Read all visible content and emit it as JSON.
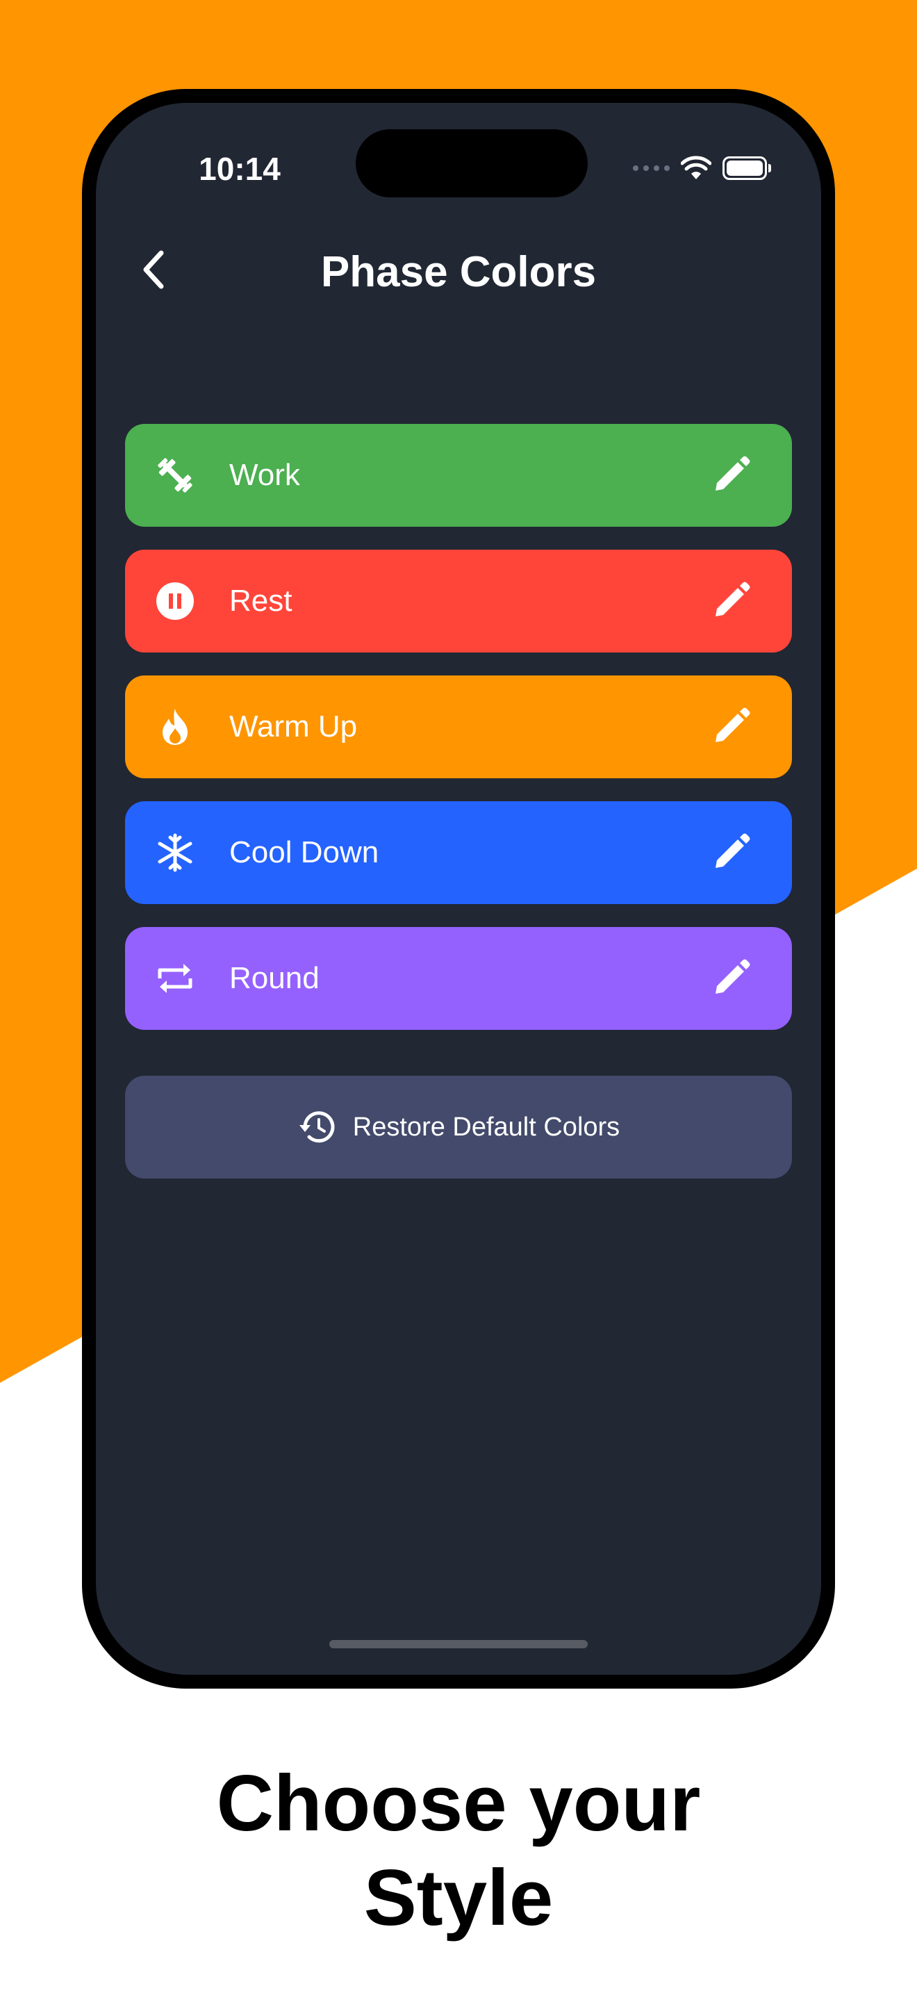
{
  "status_bar": {
    "time": "10:14",
    "wifi_icon": "wifi-icon",
    "battery_icon": "battery-icon"
  },
  "header": {
    "title": "Phase Colors",
    "back_icon": "chevron-left-icon"
  },
  "phases": [
    {
      "label": "Work",
      "color": "#4CAF50",
      "icon": "dumbbell-icon"
    },
    {
      "label": "Rest",
      "color": "#FF453A",
      "icon": "pause-circle-icon"
    },
    {
      "label": "Warm Up",
      "color": "#FF9501",
      "icon": "flame-icon"
    },
    {
      "label": "Cool Down",
      "color": "#2563FF",
      "icon": "snowflake-icon"
    },
    {
      "label": "Round",
      "color": "#9461FF",
      "icon": "repeat-icon"
    }
  ],
  "restore_button": {
    "label": "Restore Default Colors",
    "icon": "history-icon"
  },
  "caption": {
    "line1": "Choose your",
    "line2": "Style"
  },
  "colors": {
    "background_accent": "#FF9501",
    "screen": "#212733",
    "restore_button": "#434A6B"
  }
}
